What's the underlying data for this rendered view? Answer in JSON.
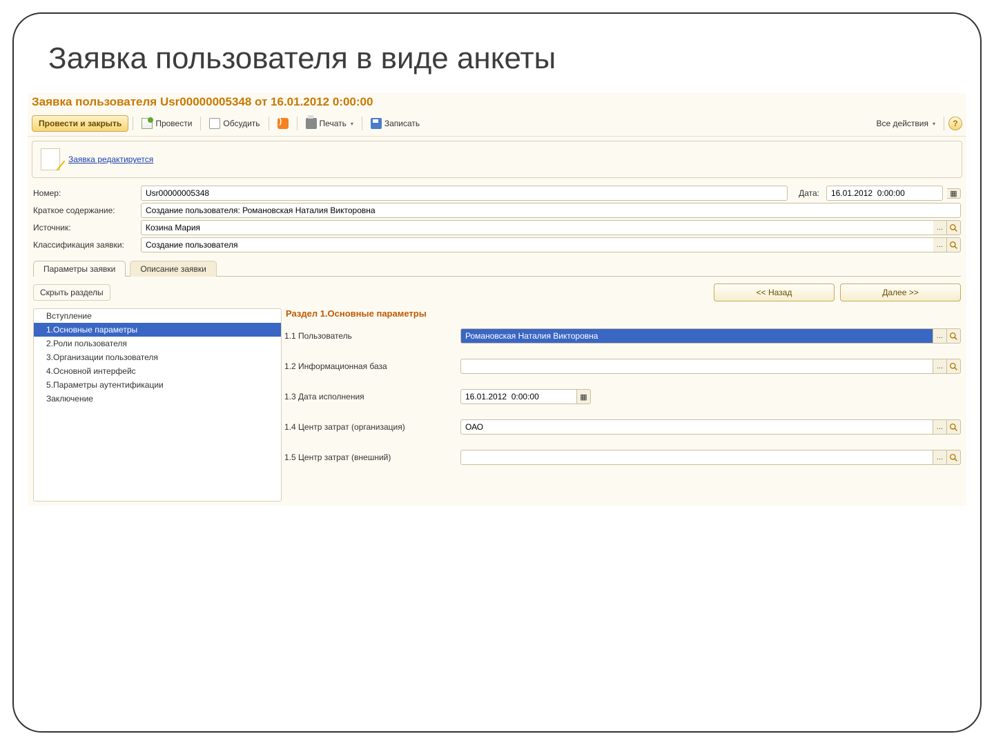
{
  "slide": {
    "title": "Заявка пользователя в виде анкеты"
  },
  "form": {
    "title": "Заявка пользователя Usr00000005348 от 16.01.2012 0:00:00"
  },
  "toolbar": {
    "post_close": "Провести и закрыть",
    "post": "Провести",
    "discuss": "Обсудить",
    "print": "Печать",
    "save": "Записать",
    "all_actions": "Все действия"
  },
  "info": {
    "link": "Заявка редактируется"
  },
  "fields": {
    "number_label": "Номер:",
    "number_value": "Usr00000005348",
    "date_label": "Дата:",
    "date_value": "16.01.2012  0:00:00",
    "summary_label": "Краткое содержание:",
    "summary_value": "Создание пользователя: Романовская Наталия Викторовна",
    "source_label": "Источник:",
    "source_value": "Козина Мария",
    "class_label": "Классификация заявки:",
    "class_value": "Создание пользователя"
  },
  "tabs": {
    "params": "Параметры заявки",
    "desc": "Описание заявки"
  },
  "tabbar": {
    "hide": "Скрыть разделы",
    "back": "<< Назад",
    "next": "Далее >>"
  },
  "tree": {
    "items": [
      "Вступление",
      "1.Основные параметры",
      "2.Роли пользователя",
      "3.Организации пользователя",
      "4.Основной интерфейс",
      "5.Параметры аутентификации",
      "Заключение"
    ]
  },
  "section": {
    "title": "Раздел 1.Основные параметры",
    "rows": [
      {
        "label": "1.1 Пользователь",
        "value": "Романовская Наталия Викторовна",
        "type": "lookup",
        "selected": true
      },
      {
        "label": "1.2 Информационная база",
        "value": "",
        "type": "lookup"
      },
      {
        "label": "1.3 Дата исполнения",
        "value": "16.01.2012  0:00:00",
        "type": "date"
      },
      {
        "label": "1.4 Центр затрат (организация)",
        "value": "ОАО",
        "type": "lookup"
      },
      {
        "label": "1.5 Центр затрат (внешний)",
        "value": "",
        "type": "lookup"
      }
    ]
  },
  "glyph": {
    "ellipsis": "...",
    "caret": "▾",
    "cal": "▦"
  }
}
